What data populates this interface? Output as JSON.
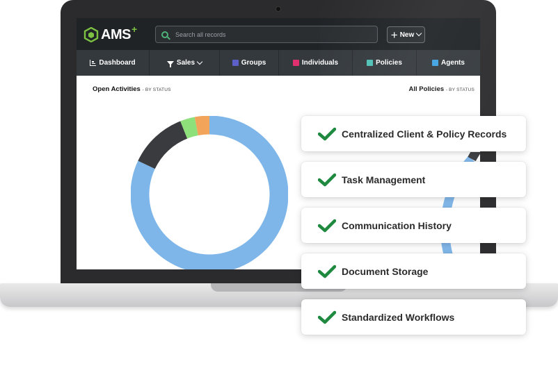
{
  "app": {
    "logo_text": "AMS",
    "logo_plus": "+",
    "brand_color": "#7cc142"
  },
  "search": {
    "placeholder": "Search all records"
  },
  "toolbar": {
    "new_label": "New"
  },
  "nav": {
    "items": [
      {
        "label": "Dashboard",
        "icon": "chart-icon"
      },
      {
        "label": "Sales",
        "icon": "funnel-icon"
      },
      {
        "label": "Groups",
        "color": "#5b5fc7"
      },
      {
        "label": "Individuals",
        "color": "#e0306e"
      },
      {
        "label": "Policies",
        "color": "#4fc1b5"
      },
      {
        "label": "Agents",
        "color": "#3ea1e0"
      }
    ]
  },
  "panels": {
    "left_title": "Open Activities",
    "left_sub": "- BY STATUS",
    "right_title": "All Policies",
    "right_sub": "- BY STATUS"
  },
  "chart_data": {
    "type": "pie",
    "values": [
      82,
      12,
      3,
      3
    ],
    "colors": [
      "#7eb6ea",
      "#3a3b3f",
      "#8ee07a",
      "#f2a45a"
    ]
  },
  "features": [
    "Centralized Client & Policy Records",
    "Task Management",
    "Communication History",
    "Document Storage",
    "Standardized Workflows"
  ],
  "colors": {
    "check": "#1f8a3f"
  }
}
